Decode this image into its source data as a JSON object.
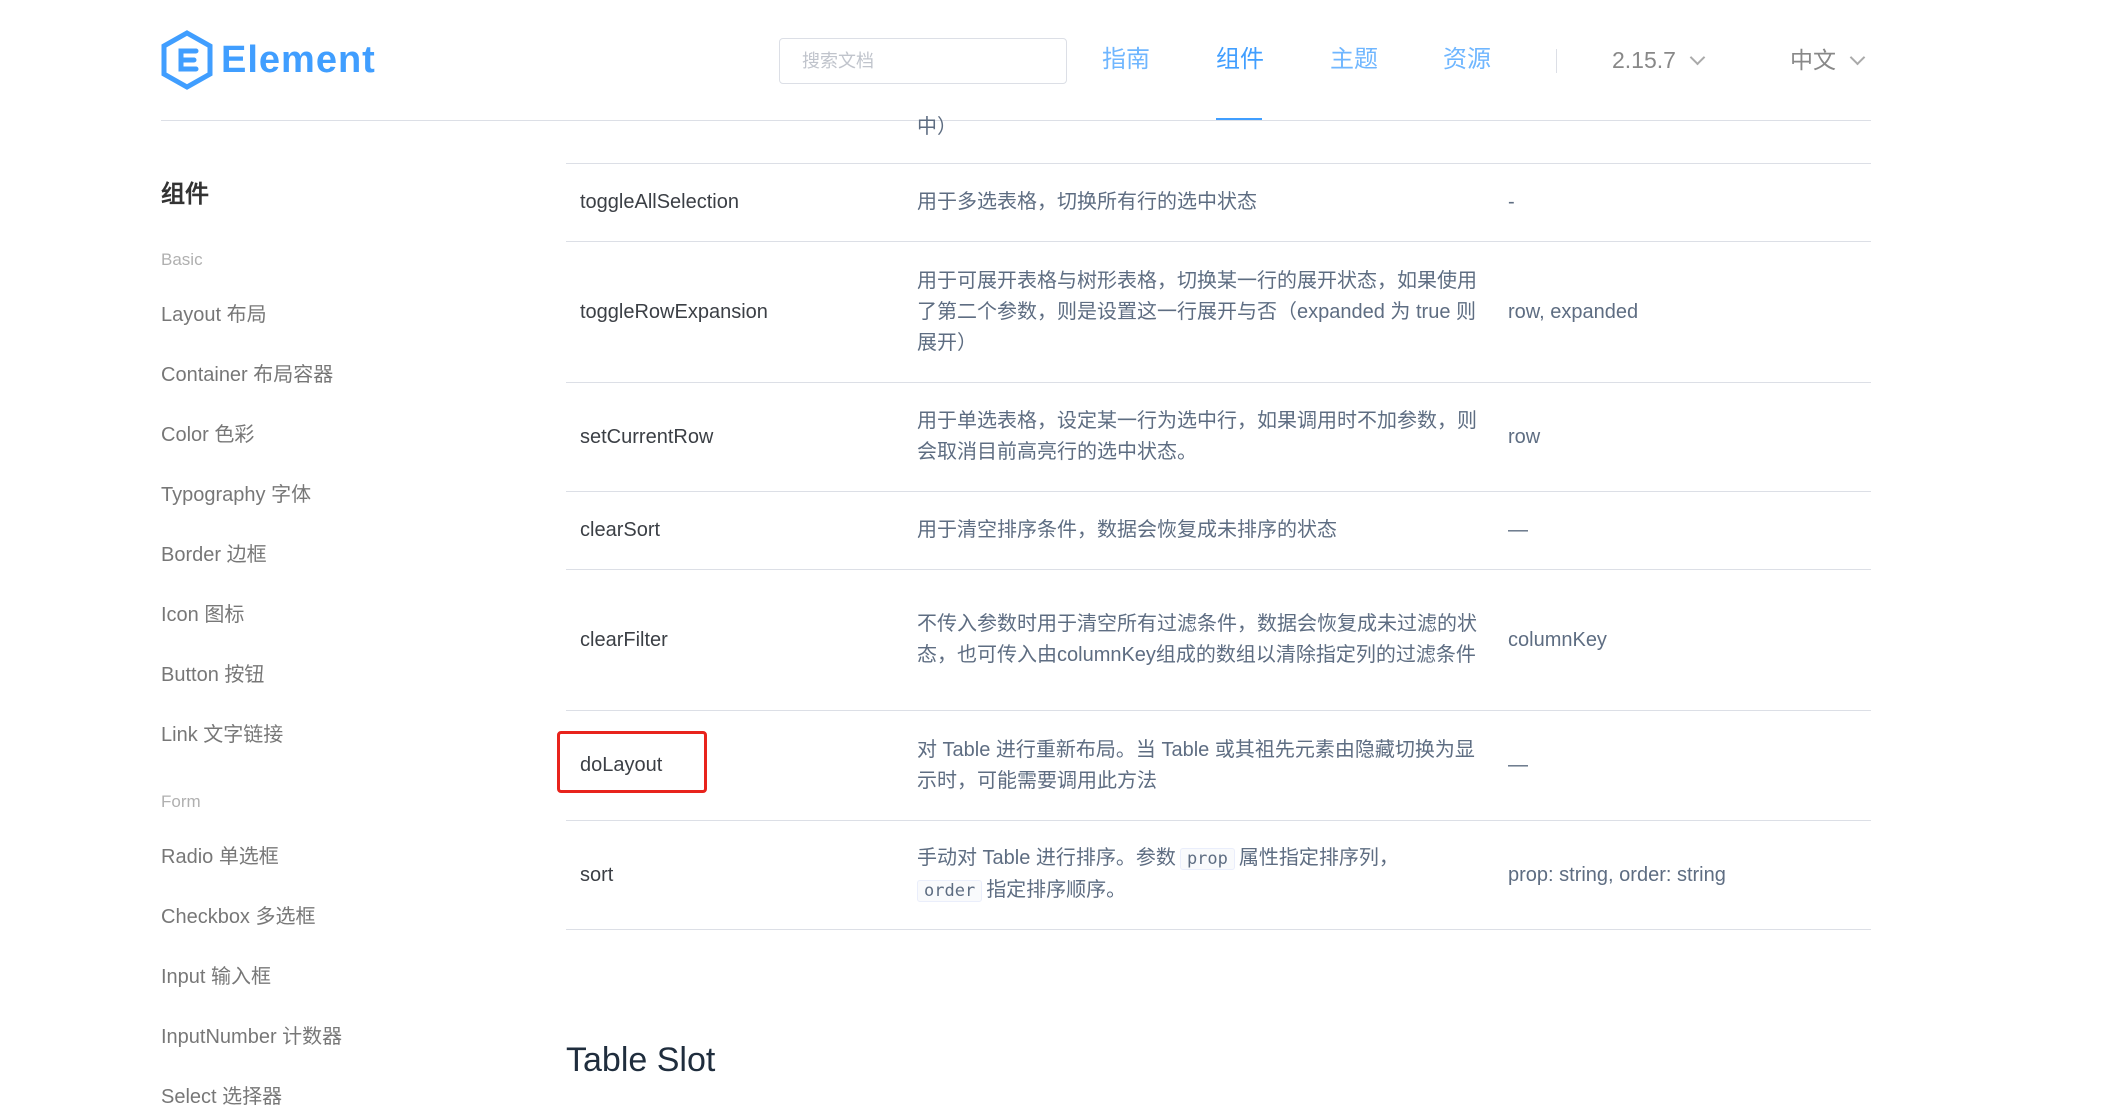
{
  "header": {
    "logo_text": "Element",
    "search_placeholder": "搜索文档",
    "nav": [
      {
        "label": "指南"
      },
      {
        "label": "组件"
      },
      {
        "label": "主题"
      },
      {
        "label": "资源"
      }
    ],
    "version": "2.15.7",
    "language": "中文"
  },
  "sidebar": {
    "title": "组件",
    "groups": [
      {
        "label": "Basic",
        "items": [
          "Layout 布局",
          "Container 布局容器",
          "Color 色彩",
          "Typography 字体",
          "Border 边框",
          "Icon 图标",
          "Button 按钮",
          "Link 文字链接"
        ]
      },
      {
        "label": "Form",
        "items": [
          "Radio 单选框",
          "Checkbox 多选框",
          "Input 输入框",
          "InputNumber 计数器",
          "Select 选择器"
        ]
      }
    ]
  },
  "table": {
    "prev_fragment": "中）",
    "rows": [
      {
        "name": "toggleAllSelection",
        "desc": "用于多选表格，切换所有行的选中状态",
        "params": "-"
      },
      {
        "name": "toggleRowExpansion",
        "desc": "用于可展开表格与树形表格，切换某一行的展开状态，如果使用了第二个参数，则是设置这一行展开与否（expanded 为 true 则展开）",
        "params": "row, expanded"
      },
      {
        "name": "setCurrentRow",
        "desc": "用于单选表格，设定某一行为选中行，如果调用时不加参数，则会取消目前高亮行的选中状态。",
        "params": "row"
      },
      {
        "name": "clearSort",
        "desc": "用于清空排序条件，数据会恢复成未排序的状态",
        "params": "—"
      },
      {
        "name": "clearFilter",
        "desc": "不传入参数时用于清空所有过滤条件，数据会恢复成未过滤的状态，也可传入由columnKey组成的数组以清除指定列的过滤条件",
        "params": "columnKey"
      },
      {
        "name": "doLayout",
        "desc": "对 Table 进行重新布局。当 Table 或其祖先元素由隐藏切换为显示时，可能需要调用此方法",
        "params": "—"
      },
      {
        "name": "sort",
        "desc_parts": [
          "手动对 Table 进行排序。参数",
          "prop",
          "属性指定排序列，",
          "order",
          "指定排序顺序。"
        ],
        "params": "prop: string, order: string"
      }
    ]
  },
  "section_title": "Table Slot",
  "colors": {
    "primary": "#409eff",
    "highlight": "#e8231c"
  }
}
